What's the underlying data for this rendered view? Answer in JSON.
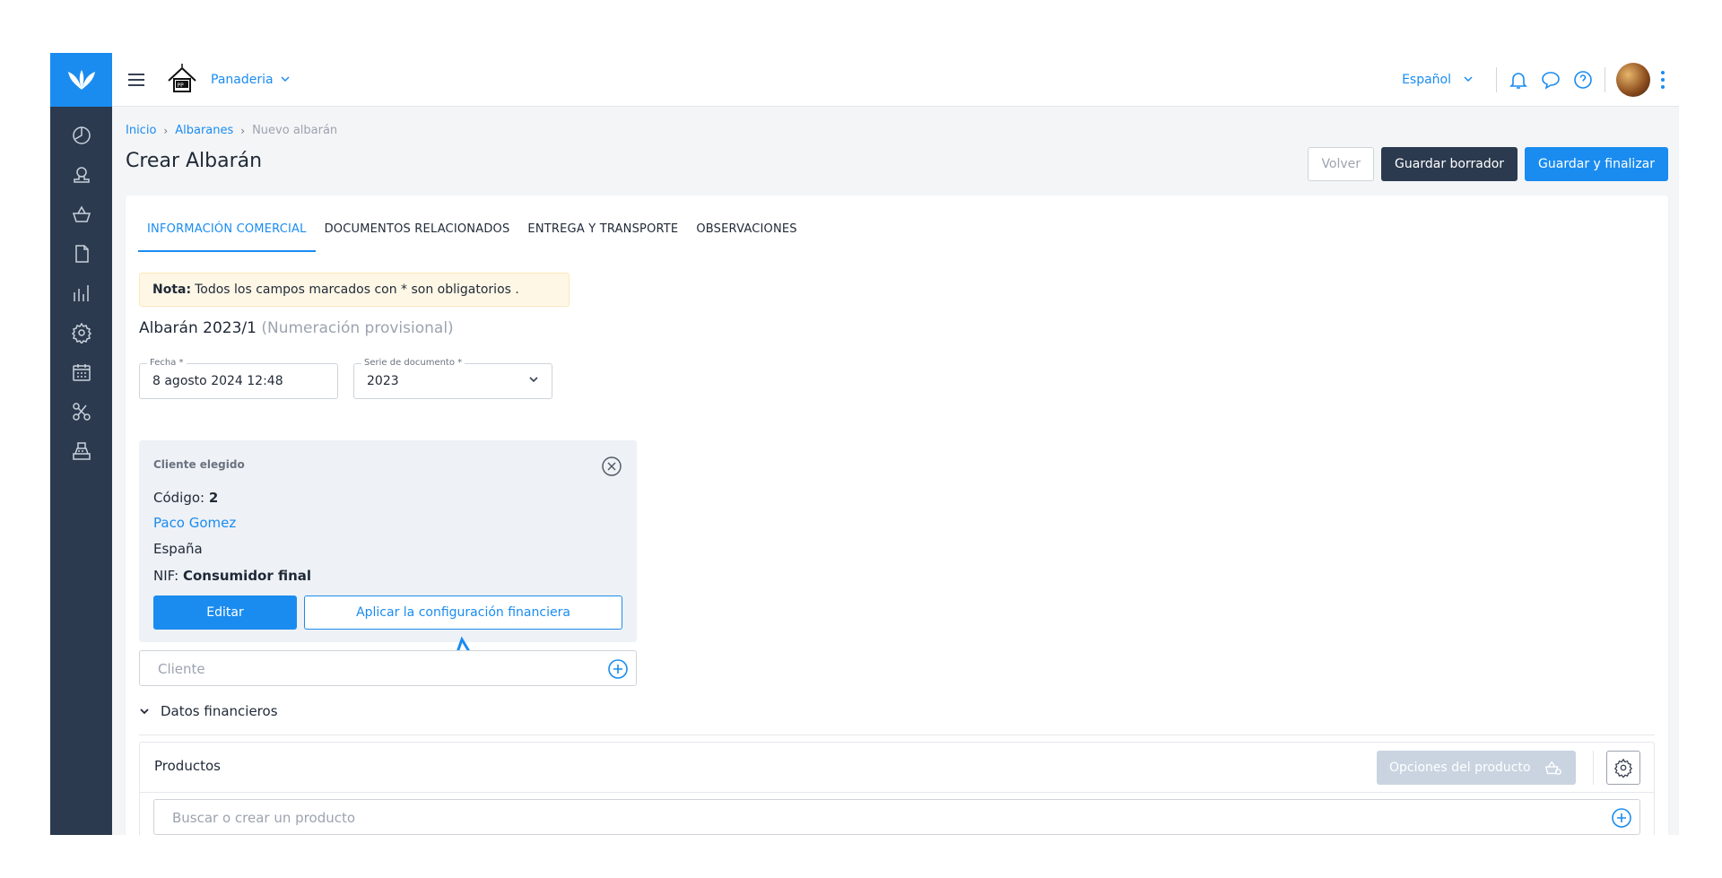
{
  "topbar": {
    "store_name": "Panaderia",
    "language": "Español",
    "icons": [
      "bell-icon",
      "chat-icon",
      "help-icon"
    ]
  },
  "sidebar": {
    "items": [
      {
        "icon": "dashboard-icon"
      },
      {
        "icon": "user-icon"
      },
      {
        "icon": "basket-icon"
      },
      {
        "icon": "document-icon"
      },
      {
        "icon": "chart-icon"
      },
      {
        "icon": "gear-icon"
      },
      {
        "icon": "calendar-icon"
      },
      {
        "icon": "integrations-icon"
      },
      {
        "icon": "cash-register-icon"
      }
    ]
  },
  "breadcrumb": {
    "home": "Inicio",
    "section": "Albaranes",
    "current": "Nuevo albarán"
  },
  "page": {
    "title": "Crear Albarán"
  },
  "actions": {
    "back": "Volver",
    "save_draft": "Guardar borrador",
    "save_finish": "Guardar y finalizar"
  },
  "tabs": [
    {
      "label": "INFORMACIÓN COMERCIAL",
      "active": true
    },
    {
      "label": "DOCUMENTOS RELACIONADOS",
      "active": false
    },
    {
      "label": "ENTREGA Y TRANSPORTE",
      "active": false
    },
    {
      "label": "OBSERVACIONES",
      "active": false
    }
  ],
  "note": {
    "label": "Nota:",
    "text": "Todos los campos marcados con * son obligatorios ."
  },
  "document": {
    "name": "Albarán 2023/1",
    "provisional": "(Numeración provisional)"
  },
  "fields": {
    "date_label": "Fecha *",
    "date_value": "8 agosto 2024 12:48",
    "series_label": "Serie de documento *",
    "series_value": "2023"
  },
  "client": {
    "title": "Cliente elegido",
    "code_label": "Código:",
    "code_value": "2",
    "name": "Paco Gomez",
    "country": "España",
    "nif_label": "NIF:",
    "nif_value": "Consumidor final",
    "edit_button": "Editar",
    "apply_button": "Aplicar la configuración financiera",
    "input_placeholder": "Cliente"
  },
  "financial": {
    "label": "Datos financieros"
  },
  "products": {
    "title": "Productos",
    "options_button": "Opciones del producto",
    "search_placeholder": "Buscar o crear un producto"
  },
  "colors": {
    "primary": "#1a8cf0",
    "sidebar": "#2c3a4f",
    "dark_button": "#2c3a4f",
    "note_bg": "#fff7e6"
  }
}
